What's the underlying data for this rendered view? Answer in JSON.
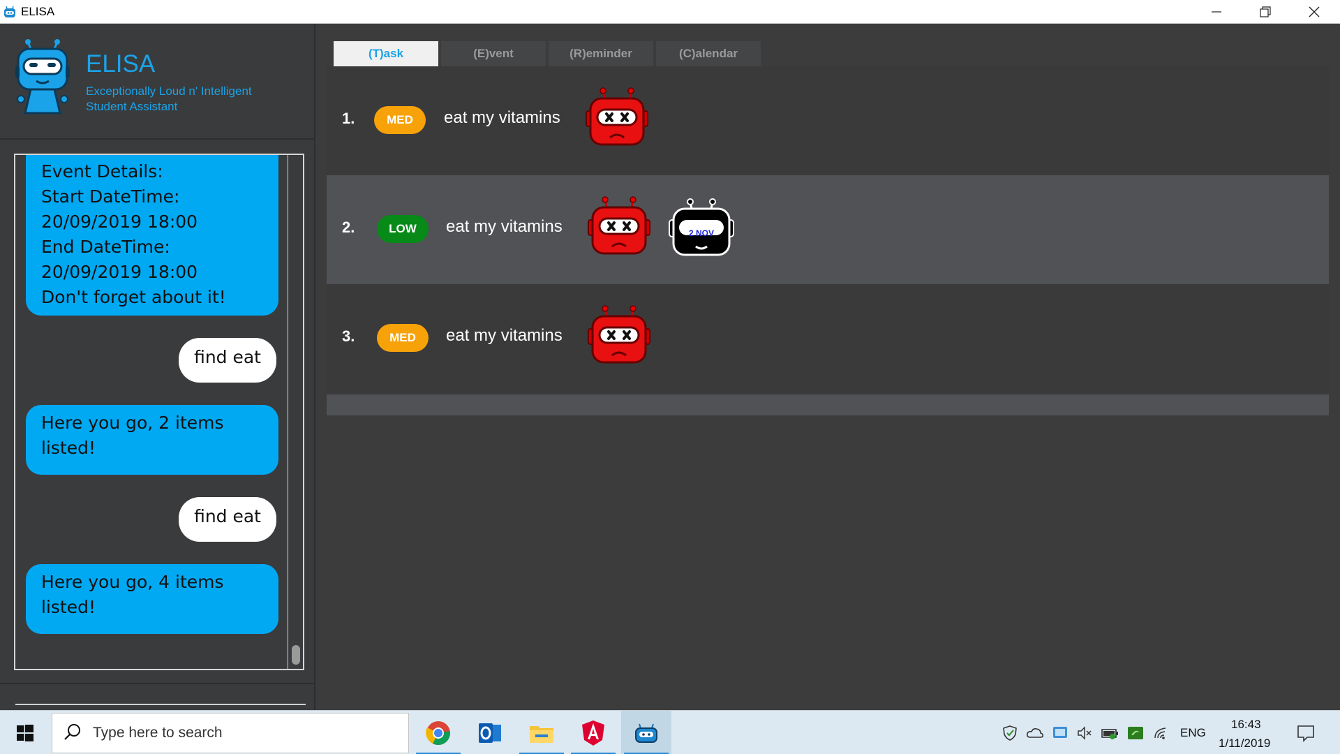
{
  "window": {
    "title": "ELISA",
    "controls": [
      "minimize",
      "restore",
      "close"
    ]
  },
  "brand": {
    "name": "ELISA",
    "tagline_line1": "Exceptionally Loud n' Intelligent",
    "tagline_line2": "Student Assistant",
    "accent_color": "#1aa3e8"
  },
  "chat": {
    "messages": [
      {
        "from": "bot",
        "lines": [
          "Event Details:",
          "Start DateTime:",
          "20/09/2019 18:00",
          "End DateTime:",
          "20/09/2019 18:00",
          "Don't forget about it!"
        ]
      },
      {
        "from": "user",
        "lines": [
          "find eat"
        ]
      },
      {
        "from": "bot",
        "lines": [
          "Here you go, 2 items",
          "listed!"
        ]
      },
      {
        "from": "user",
        "lines": [
          "find eat"
        ]
      },
      {
        "from": "bot",
        "lines": [
          "Here you go, 4 items",
          "listed!"
        ]
      }
    ],
    "bot_bubble_color": "#01a9f3",
    "user_bubble_color": "#ffffff"
  },
  "tabs": [
    {
      "label": "(T)ask",
      "active": true
    },
    {
      "label": "(E)vent",
      "active": false
    },
    {
      "label": "(R)eminder",
      "active": false
    },
    {
      "label": "(C)alendar",
      "active": false
    }
  ],
  "tasks": [
    {
      "index": "1.",
      "priority": "MED",
      "description": "eat my vitamins",
      "status_icon": "robot-sad-icon",
      "date_badge": null
    },
    {
      "index": "2.",
      "priority": "LOW",
      "description": "eat my vitamins",
      "status_icon": "robot-sad-icon",
      "date_badge": "2 NOV"
    },
    {
      "index": "3.",
      "priority": "MED",
      "description": "eat my vitamins",
      "status_icon": "robot-sad-icon",
      "date_badge": null
    }
  ],
  "priority_colors": {
    "MED": "#f7a209",
    "LOW": "#078a18"
  },
  "taskbar": {
    "search_placeholder": "Type here to search",
    "apps": [
      "chrome-icon",
      "outlook-icon",
      "file-explorer-icon",
      "angular-icon",
      "elisa-icon"
    ],
    "language": "ENG",
    "time": "16:43",
    "date": "1/11/2019"
  }
}
